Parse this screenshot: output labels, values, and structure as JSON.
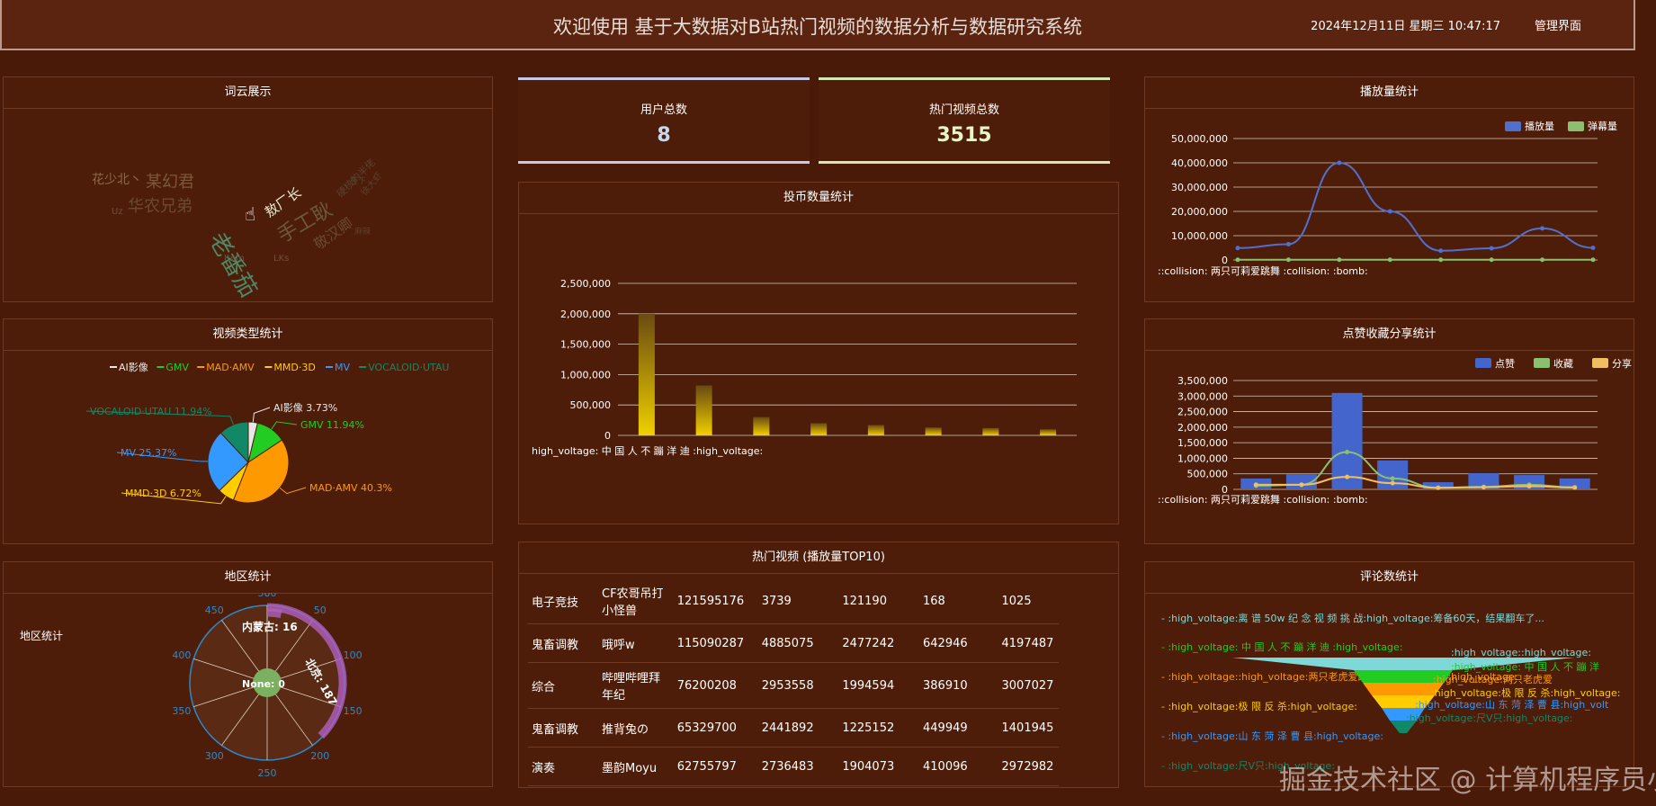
{
  "header": {
    "title": "欢迎使用 基于大数据对B站热门视频的数据分析与数据研究系统",
    "datetime": "2024年12月11日 星期三 10:47:17",
    "admin_link": "管理界面"
  },
  "panels": {
    "wordcloud_title": "词云展示",
    "video_type_title": "视频类型统计",
    "region_title": "地区统计",
    "region_inner_label": "地区统计",
    "coin_title": "投币数量统计",
    "top10_title": "热门视频 (播放量TOP10)",
    "play_title": "播放量统计",
    "like_title": "点赞收藏分享统计",
    "comment_title": "评论数统计"
  },
  "stats": {
    "users_label": "用户总数",
    "users_value": "8",
    "videos_label": "热门视频总数",
    "videos_value": "3515"
  },
  "wordcloud": {
    "words": [
      "花少北丶",
      "某幻君",
      "华农兄弟",
      "老番茄",
      "敖厂长",
      "手工耿",
      "硬核的半佬",
      "徐大虾",
      "LKs",
      "Item",
      "Uz",
      "在下",
      "敬汉卿",
      "麻辣"
    ]
  },
  "chart_data": [
    {
      "type": "pie",
      "legend": [
        "AI影像",
        "GMV",
        "MAD·AMV",
        "MMD·3D",
        "MV",
        "VOCALOID·UTAU"
      ],
      "labels": [
        "AI影像 3.73%",
        "GMV 11.94%",
        "MAD·AMV 40.3%",
        "MMD·3D 6.72%",
        "MV 25.37%",
        "VOCALOID·UTAU 11.94%"
      ],
      "values": [
        3.73,
        11.94,
        40.3,
        6.72,
        25.37,
        11.94
      ],
      "colors": [
        "#e8e8e8",
        "#22cc22",
        "#ff9900",
        "#ffcc00",
        "#3399ff",
        "#118866"
      ]
    },
    {
      "type": "polar-bar",
      "angle_ticks": [
        "0",
        "50",
        "100",
        "150",
        "200",
        "250",
        "300",
        "350",
        "400",
        "450",
        "500"
      ],
      "labels": [
        "内蒙古: 16",
        "北京: 187",
        "None: 0"
      ],
      "values": [
        16,
        187,
        0
      ],
      "angle_max": 500
    },
    {
      "type": "bar",
      "title": "",
      "categories": [
        ":high_voltage: 中 国 人 不 蹦 洋 迪 :high_voltage:",
        "",
        "",
        "",
        "",
        "",
        "",
        ""
      ],
      "values": [
        2000000,
        820000,
        300000,
        200000,
        170000,
        130000,
        120000,
        100000
      ],
      "ylim": [
        0,
        2500000
      ],
      "y_ticks": [
        "0",
        "500,000",
        "1,000,000",
        "1,500,000",
        "2,000,000",
        "2,500,000"
      ],
      "x_label_shown": "high_voltage: 中 国 人 不 蹦 洋 迪 :high_voltage:"
    },
    {
      "type": "line",
      "series": [
        {
          "name": "播放量",
          "values": [
            4900000,
            6500000,
            40000000,
            20000000,
            3800000,
            4800000,
            13000000,
            5000000
          ]
        },
        {
          "name": "弹幕量",
          "values": [
            100000,
            100000,
            100000,
            100000,
            100000,
            100000,
            100000,
            100000
          ]
        }
      ],
      "ylim": [
        0,
        50000000
      ],
      "y_ticks": [
        "0",
        "10,000,000",
        "20,000,000",
        "30,000,000",
        "40,000,000",
        "50,000,000"
      ],
      "x_label_shown": "::collision: 两只可莉爱跳舞 :collision: :bomb:"
    },
    {
      "type": "bar",
      "series": [
        {
          "name": "点赞",
          "values": [
            350000,
            480000,
            3100000,
            930000,
            230000,
            520000,
            460000,
            350000
          ]
        },
        {
          "name": "收藏",
          "values": [
            120000,
            150000,
            1200000,
            350000,
            50000,
            80000,
            150000,
            60000
          ]
        },
        {
          "name": "分享",
          "values": [
            150000,
            150000,
            400000,
            200000,
            50000,
            70000,
            100000,
            60000
          ]
        }
      ],
      "ylim": [
        0,
        3500000
      ],
      "y_ticks": [
        "0",
        "500,000",
        "1,000,000",
        "1,500,000",
        "2,000,000",
        "2,500,000",
        "3,000,000",
        "3,500,000"
      ],
      "x_label_shown": "::collision: 两只可莉爱跳舞 :collision: :bomb:"
    },
    {
      "type": "funnel",
      "legend": [
        "- :high_voltage:离 谱 50w 纪 念 视 频 挑 战:high_voltage:筹备60天，结果翻车了...",
        "- :high_voltage: 中 国 人 不 蹦 洋 迪 :high_voltage:",
        "- :high_voltage::high_voltage:两只老虎爱跳舞:high_voltage::high_voltage:",
        "- :high_voltage:极 限 反 杀:high_voltage:",
        "- :high_voltage:山 东 菏 泽 曹 县:high_voltage:",
        "- :high_voltage:尺V只:high_voltage:"
      ],
      "labels": [
        ":high_voltage::high_voltage:",
        ":high_voltage: 中 国 人 不 蹦 洋",
        ":high_voltage:两只老虎爱",
        ":high_voltage:极 限 反 杀:high_voltage:",
        ":high_voltage:山 东 菏 泽 曹 县:high_volt",
        ":high_voltage:尺V只:high_voltage:"
      ],
      "colors": [
        "#7fd8d8",
        "#22cc22",
        "#ff9900",
        "#ffcc00",
        "#3399ff",
        "#118866"
      ]
    }
  ],
  "top10": {
    "rows": [
      [
        "电子竞技",
        "CF农哥吊打小怪兽",
        "121595176",
        "3739",
        "121190",
        "168",
        "1025"
      ],
      [
        "鬼畜调教",
        "哦呼w",
        "115090287",
        "4885075",
        "2477242",
        "642946",
        "4197487"
      ],
      [
        "综合",
        "哔哩哔哩拜年纪",
        "76200208",
        "2953558",
        "1994594",
        "386910",
        "3007027"
      ],
      [
        "鬼畜调教",
        "推背兔の",
        "65329700",
        "2441892",
        "1225152",
        "449949",
        "1401945"
      ],
      [
        "演奏",
        "墨韵Moyu",
        "62755797",
        "2736483",
        "1904073",
        "410096",
        "2972982"
      ]
    ]
  },
  "watermark": "掘金技术社区 @ 计算机程序员小杨"
}
